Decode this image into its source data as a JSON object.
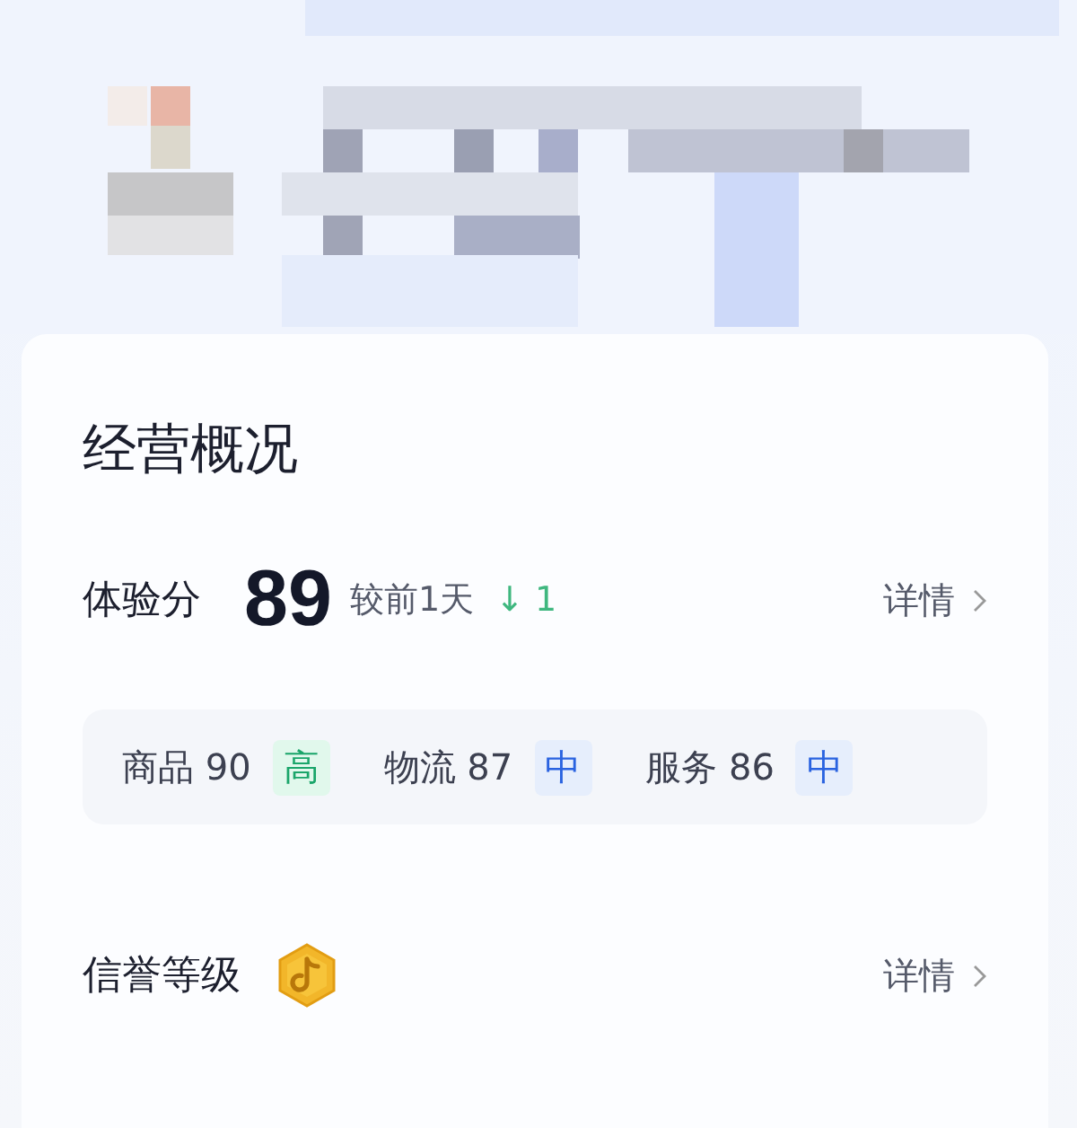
{
  "overview": {
    "title": "经营概况",
    "score": {
      "label": "体验分",
      "value": "89",
      "compare_label": "较前1天",
      "change_arrow": "↓",
      "change": "1",
      "link": "详情"
    },
    "metrics": [
      {
        "name": "商品",
        "value": "90",
        "tag": "高",
        "kind": "high"
      },
      {
        "name": "物流",
        "value": "87",
        "tag": "中",
        "kind": "medium"
      },
      {
        "name": "服务",
        "value": "86",
        "tag": "中",
        "kind": "medium"
      }
    ],
    "credit": {
      "label": "信誉等级",
      "link": "详情"
    }
  }
}
